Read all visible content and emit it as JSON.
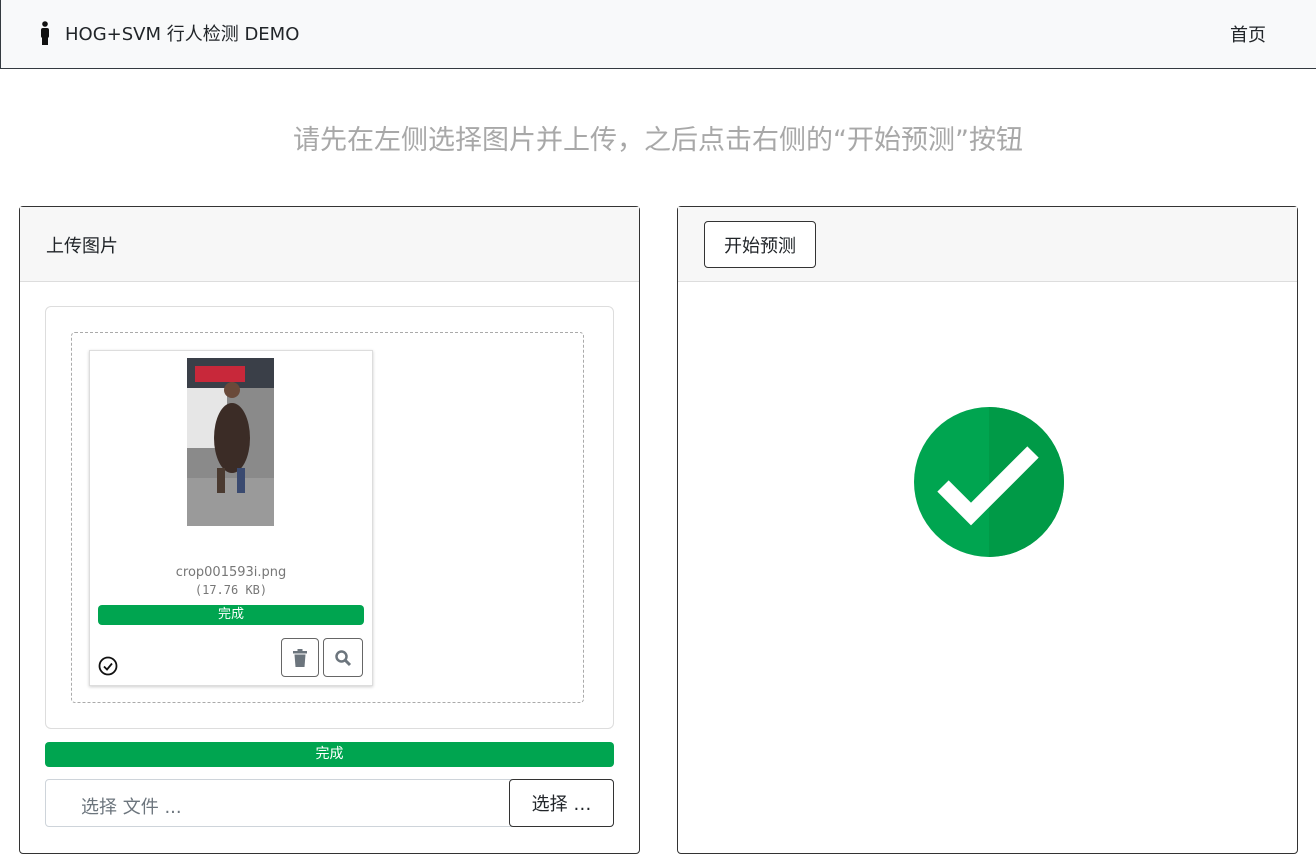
{
  "navbar": {
    "brand_icon": "person-icon",
    "title": "HOG+SVM 行人检测 DEMO",
    "home_link": "首页"
  },
  "instruction": "请先在左侧选择图片并上传，之后点击右侧的“开始预测”按钮",
  "upload_card": {
    "title": "上传图片",
    "preview": {
      "file_name": "crop001593i.png",
      "file_size": "(17.76 KB)",
      "progress_label": "完成",
      "progress_percent": 100,
      "delete_icon": "trash-icon",
      "zoom_icon": "search-icon",
      "status_icon": "check-circle-icon"
    },
    "overall_progress_label": "完成",
    "overall_progress_percent": 100,
    "file_input_placeholder": "选择 文件 ...",
    "browse_button": "选择 …"
  },
  "predict_card": {
    "start_button": "开始预测",
    "result_icon": "success-check-icon"
  },
  "colors": {
    "success": "#00a550",
    "muted_text": "#a8a8a8"
  }
}
